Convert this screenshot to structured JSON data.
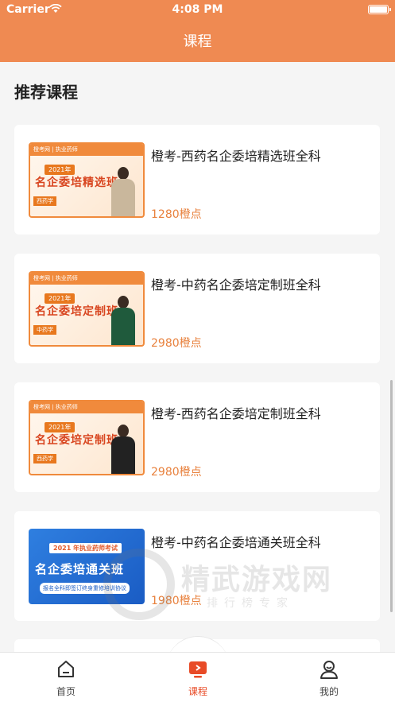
{
  "status": {
    "carrier": "Carrier",
    "time": "4:08 PM"
  },
  "header": {
    "title": "课程"
  },
  "section": {
    "title": "推荐课程"
  },
  "courses": [
    {
      "title": "橙考-西药名企委培精选班全科",
      "price": "1280橙点",
      "thumb": {
        "topbar": "橙考网 | 执业药师",
        "year": "2021年",
        "name": "名企委培精选班",
        "subject": "西药学"
      }
    },
    {
      "title": "橙考-中药名企委培定制班全科",
      "price": "2980橙点",
      "thumb": {
        "topbar": "橙考网 | 执业药师",
        "year": "2021年",
        "name": "名企委培定制班",
        "subject": "中药学"
      }
    },
    {
      "title": "橙考-西药名企委培定制班全科",
      "price": "2980橙点",
      "thumb": {
        "topbar": "橙考网 | 执业药师",
        "year": "2021年",
        "name": "名企委培定制班",
        "subject": "西药学"
      }
    },
    {
      "title": "橙考-中药名企委培通关班全科",
      "price": "1980橙点",
      "thumb": {
        "year": "2021 年执业药师考试",
        "name": "名企委培通关班",
        "banner": "报名全科即签订终身重修培训协议"
      }
    }
  ],
  "watermark": {
    "title": "精武游戏网",
    "subtitle": "排行榜专家"
  },
  "tabbar": [
    {
      "label": "首页",
      "icon": "home-icon",
      "active": false
    },
    {
      "label": "课程",
      "icon": "course-icon",
      "active": true
    },
    {
      "label": "我的",
      "icon": "profile-icon",
      "active": false
    }
  ],
  "colors": {
    "header": "#ef8a52",
    "price": "#e8813d",
    "active_tab": "#e84b27"
  }
}
